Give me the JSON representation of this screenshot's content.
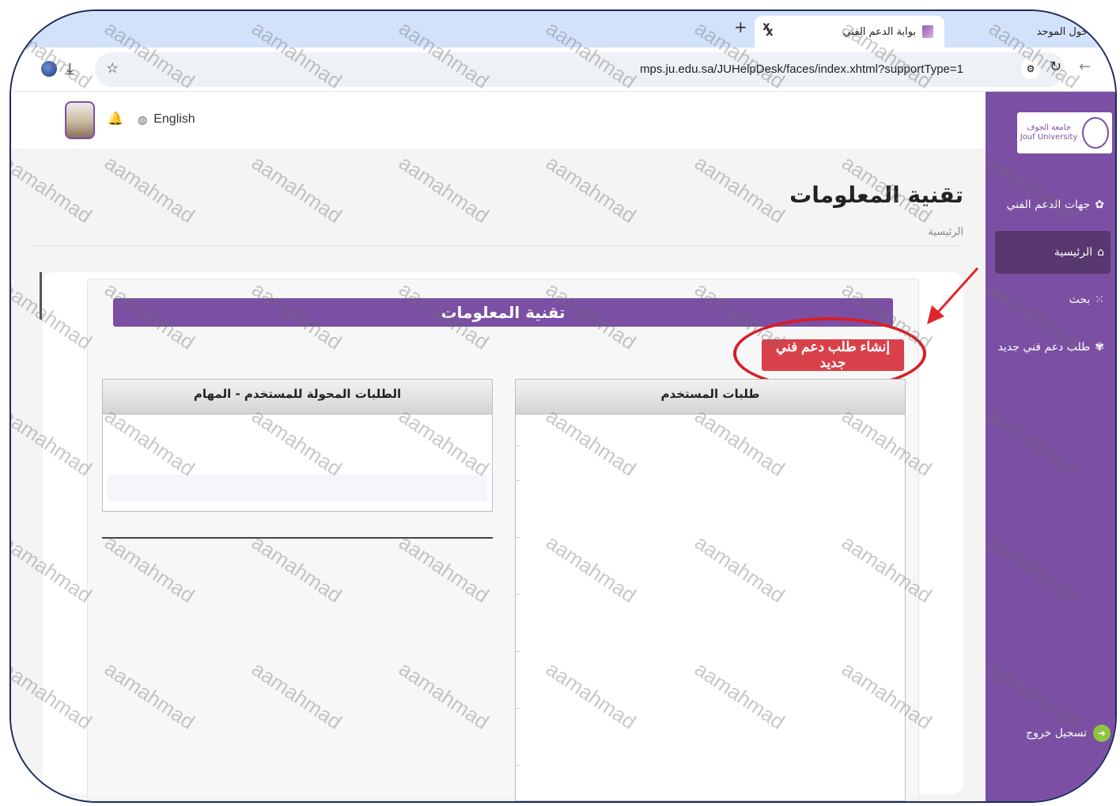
{
  "browser": {
    "tabs": [
      {
        "title": "الدخول الموحد"
      },
      {
        "title": "بوابة الدعم الفني",
        "close": "x"
      }
    ],
    "new_tab": "+",
    "prev_close": "x",
    "url": "mps.ju.edu.sa/JUHelpDesk/faces/index.xhtml?supportType=1"
  },
  "topbar": {
    "language": "English"
  },
  "sidebar": {
    "logo_text": [
      "جامعة الجوف",
      "Jouf University"
    ],
    "items": [
      {
        "label": "جهات الدعم الفني",
        "icon": "support-icon"
      },
      {
        "label": "الرئيسية",
        "icon": "home-icon",
        "active": true
      },
      {
        "label": "بحث",
        "icon": "grid-search-icon"
      },
      {
        "label": "طلب دعم فني جديد",
        "icon": "new-request-icon"
      }
    ],
    "logout": "تسجيل خروج"
  },
  "page": {
    "title": "تقنية المعلومات",
    "breadcrumb": "الرئيسية",
    "panel_header": "تقنية المعلومات",
    "new_request_button": "إنشاء طلب دعم فني جديد",
    "user_requests_header": "طلبات المستخدم",
    "transferred_header": "الطلبات المحولة للمستخدم - المهام"
  },
  "annotations": {
    "highlight_color": "#d81e26"
  },
  "watermark": "aamahmad",
  "colors": {
    "brand_purple": "#7b4fa3",
    "active_nav": "#58386f",
    "button_red": "#d9414a"
  }
}
